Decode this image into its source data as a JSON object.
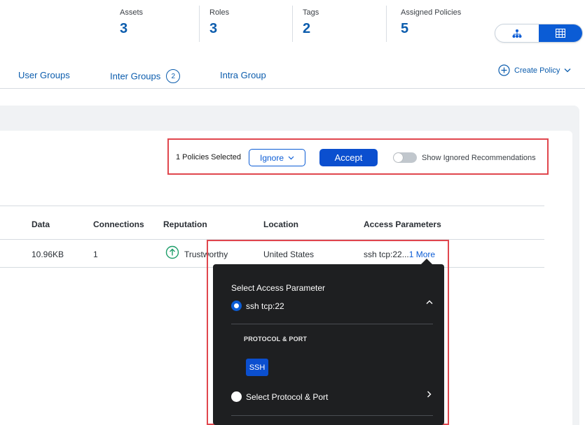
{
  "stats": [
    {
      "label": "Assets",
      "value": "3"
    },
    {
      "label": "Roles",
      "value": "3"
    },
    {
      "label": "Tags",
      "value": "2"
    },
    {
      "label": "Assigned Policies",
      "value": "5"
    }
  ],
  "view_toggle": {
    "left_icon": "topology-icon",
    "right_icon": "table-icon",
    "active": "table"
  },
  "tabs": [
    {
      "label": "User Groups"
    },
    {
      "label": "Inter Groups",
      "count": "2"
    },
    {
      "label": "Intra Group"
    }
  ],
  "create_policy": {
    "label": "Create Policy",
    "icon": "plus-circle-icon"
  },
  "actions": {
    "selected_text": "1 Policies Selected",
    "ignore_label": "Ignore",
    "accept_label": "Accept",
    "toggle_label": "Show Ignored Recommendations",
    "toggle_on": false
  },
  "table": {
    "headers": [
      "Data",
      "Connections",
      "Reputation",
      "Location",
      "Access Parameters"
    ],
    "rows": [
      {
        "data": "10.96KB",
        "connections": "1",
        "reputation": "Trustworthy",
        "location": "United States",
        "access": "ssh tcp:22...",
        "more": "1 More"
      }
    ]
  },
  "dropdown": {
    "title": "Select Access Parameter",
    "option1": "ssh tcp:22",
    "subhead": "PROTOCOL & PORT",
    "chip": "SSH",
    "option2": "Select Protocol & Port"
  },
  "colors": {
    "accent": "#0b5cd5",
    "highlight": "#e0464d",
    "dropdown_bg": "#1e1f21"
  }
}
